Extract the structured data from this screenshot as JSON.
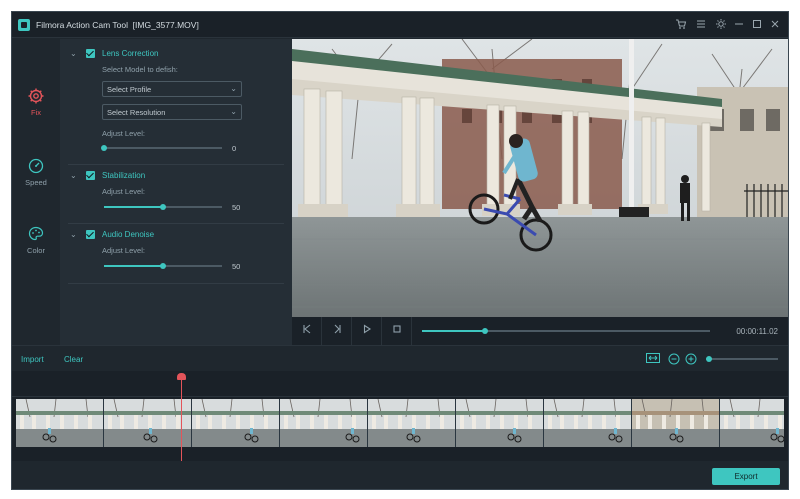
{
  "window": {
    "title": "Filmora Action Cam Tool  [IMG_3577.MOV]",
    "icons": [
      "cart-icon",
      "list-icon",
      "brightness-icon",
      "minimize-icon",
      "maximize-icon",
      "close-icon"
    ]
  },
  "colors": {
    "accent": "#3ec6c0",
    "active": "#e3545a",
    "background": "#1f272e",
    "panel": "#252e36"
  },
  "sidebar": {
    "items": [
      {
        "label": "Fix",
        "icon": "gear-icon",
        "active": true
      },
      {
        "label": "Speed",
        "icon": "speedometer-icon",
        "active": false
      },
      {
        "label": "Color",
        "icon": "palette-icon",
        "active": false
      }
    ]
  },
  "fix_panel": {
    "lens": {
      "title": "Lens Correction",
      "checked": true,
      "select_label": "Select Model to defish:",
      "profile_value": "Select Profile",
      "resolution_value": "Select Resolution",
      "adjust_label": "Adjust Level:",
      "level": 0
    },
    "stabilization": {
      "title": "Stabilization",
      "checked": true,
      "adjust_label": "Adjust Level:",
      "level": 50
    },
    "audio": {
      "title": "Audio Denoise",
      "checked": true,
      "adjust_label": "Adjust Level:",
      "level": 50
    }
  },
  "player": {
    "buttons": [
      "skip-start-icon",
      "step-frame-icon",
      "play-icon",
      "stop-icon"
    ],
    "progress": 0.22,
    "timecode": "00:00:11.02"
  },
  "toolbar": {
    "import_label": "Import",
    "clear_label": "Clear",
    "zoom_level": 0
  },
  "timeline": {
    "frame_count": 9,
    "playhead_fraction": 0.215
  },
  "footer": {
    "export_label": "Export"
  }
}
